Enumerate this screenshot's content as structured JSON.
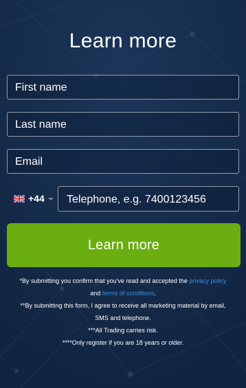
{
  "form": {
    "title": "Learn more",
    "first_name_placeholder": "First name",
    "last_name_placeholder": "Last name",
    "email_placeholder": "Email",
    "country_code": "+44",
    "country_flag": "uk-flag-icon",
    "telephone_placeholder": "Telephone, e.g. 7400123456",
    "submit_label": "Learn more"
  },
  "legal": {
    "line1_prefix": "*By submitting you confirm that you've read and accepted the ",
    "privacy_link": "privacy policy",
    "line2_prefix": "and ",
    "terms_link": "terms of conditions",
    "line2_suffix": ".",
    "line3": "**By submitting this form, I agree to receive all marketing material by email,",
    "line4": "SMS and telephone.",
    "line5": "***All Trading carries risk.",
    "line6": "****Only register if you are 18 years or older."
  },
  "colors": {
    "background": "#142a49",
    "button": "#6aae12",
    "link": "#3a8ee6"
  }
}
